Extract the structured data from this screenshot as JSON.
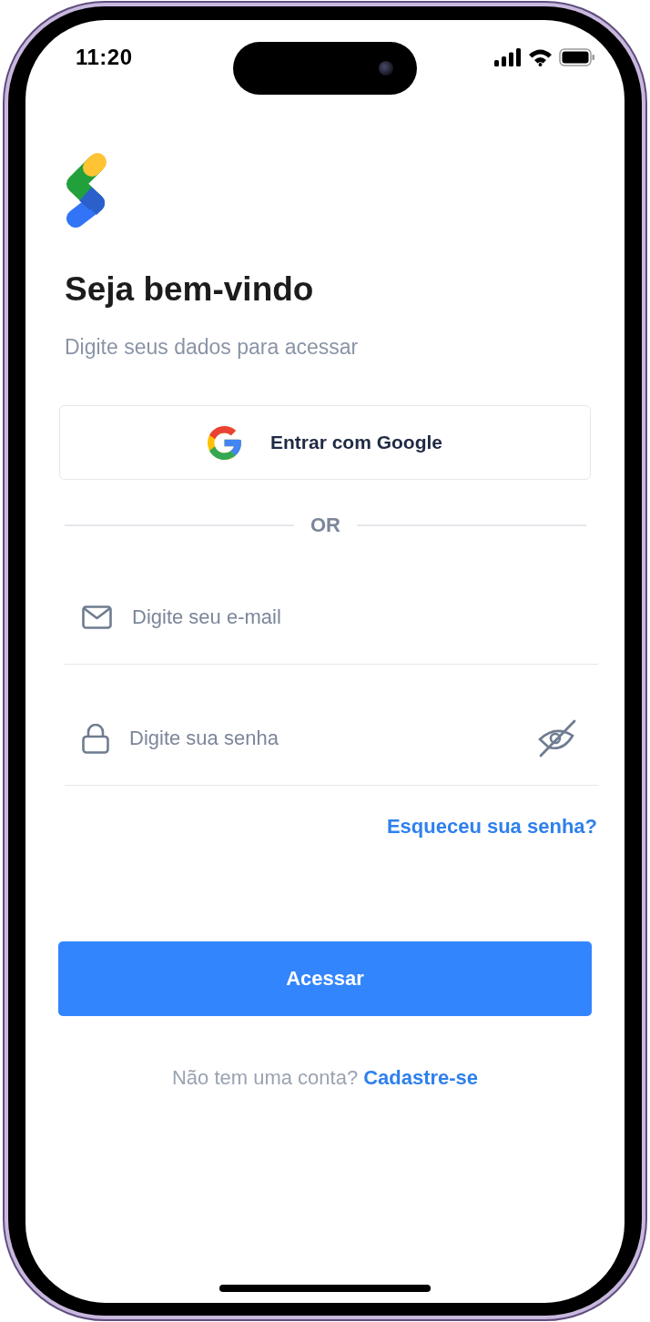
{
  "status_bar": {
    "time": "11:20"
  },
  "title": "Seja bem-vindo",
  "subtitle": "Digite seus dados para acessar",
  "google_button": {
    "label": "Entrar com Google"
  },
  "divider": {
    "label": "OR"
  },
  "fields": [
    {
      "kind": "email",
      "placeholder": "Digite seu e-mail"
    },
    {
      "kind": "password",
      "placeholder": "Digite sua senha",
      "password_visible": false
    }
  ],
  "forgot_link": "Esqueceu sua senha?",
  "submit_button": {
    "label": "Acessar"
  },
  "signup": {
    "prompt": "Não tem uma conta?",
    "link": "Cadastre-se"
  }
}
